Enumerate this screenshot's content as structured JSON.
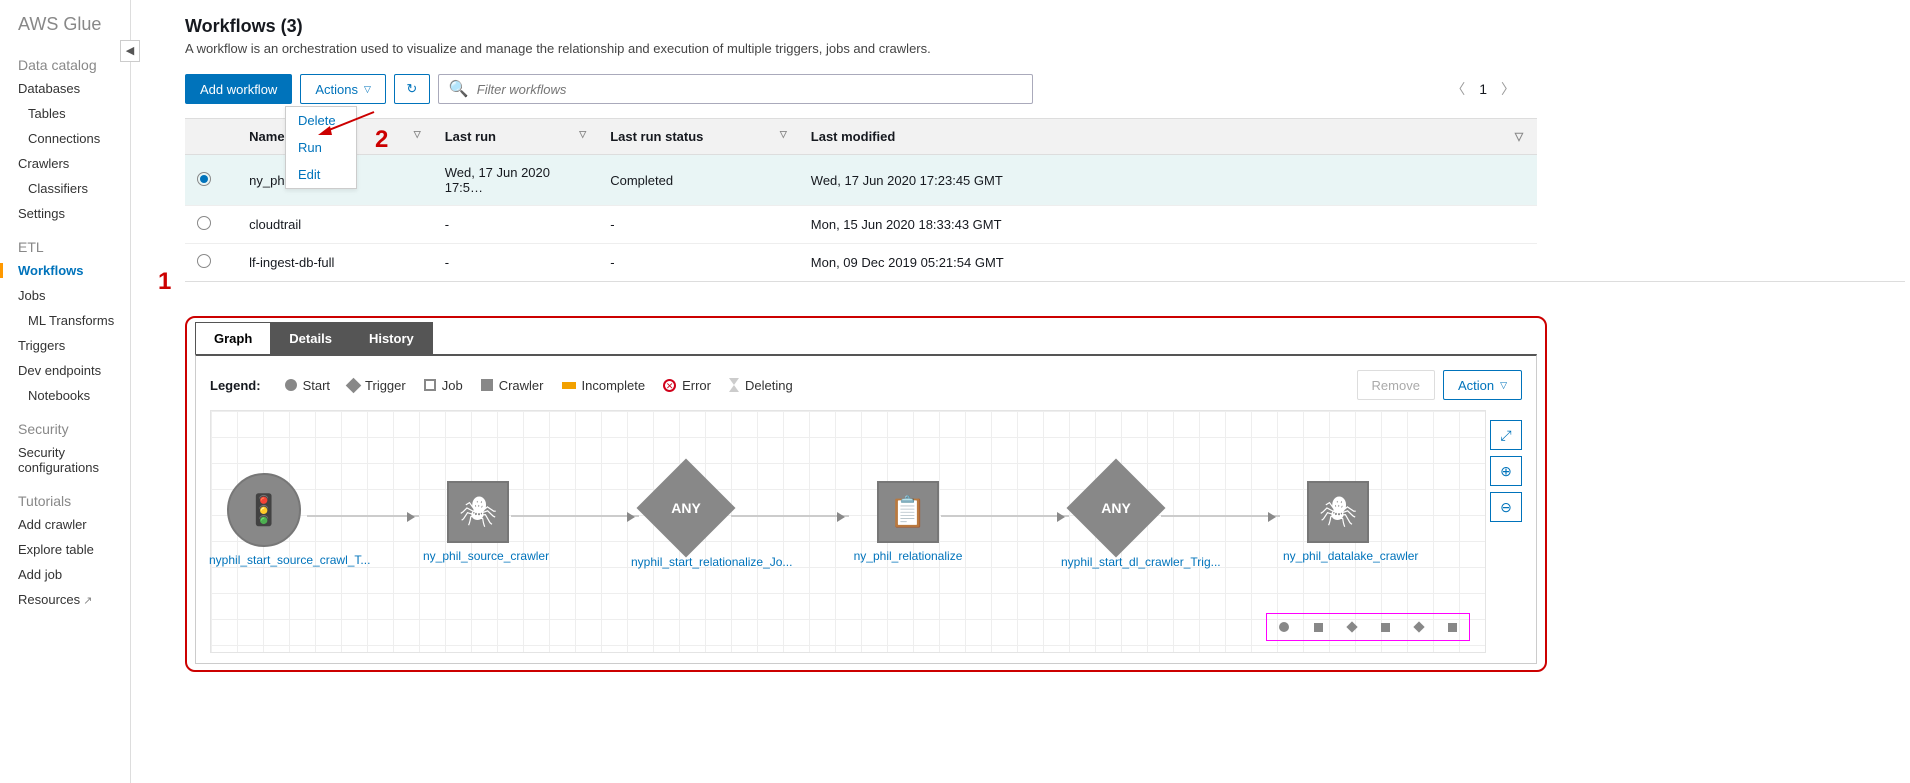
{
  "brand": "AWS Glue",
  "sidebar": {
    "catalog_header": "Data catalog",
    "etl_header": "ETL",
    "security_header": "Security",
    "tutorials_header": "Tutorials",
    "items": {
      "databases": "Databases",
      "tables": "Tables",
      "connections": "Connections",
      "crawlers": "Crawlers",
      "classifiers": "Classifiers",
      "settings": "Settings",
      "workflows": "Workflows",
      "jobs": "Jobs",
      "ml_transforms": "ML Transforms",
      "triggers": "Triggers",
      "dev_endpoints": "Dev endpoints",
      "notebooks": "Notebooks",
      "security_config": "Security configurations",
      "add_crawler": "Add crawler",
      "explore_table": "Explore table",
      "add_job": "Add job",
      "resources": "Resources"
    }
  },
  "page": {
    "title": "Workflows (3)",
    "desc": "A workflow is an orchestration used to visualize and manage the relationship and execution of multiple triggers, jobs and crawlers."
  },
  "toolbar": {
    "add": "Add workflow",
    "actions": "Actions",
    "filter_placeholder": "Filter workflows",
    "page_number": "1",
    "dropdown": {
      "delete": "Delete",
      "run": "Run",
      "edit": "Edit"
    }
  },
  "table": {
    "headers": {
      "name": "Name",
      "last_run": "Last run",
      "status": "Last run status",
      "modified": "Last modified"
    },
    "rows": [
      {
        "selected": true,
        "name": "ny_phil",
        "last_run": "Wed, 17 Jun 2020 17:5…",
        "status": "Completed",
        "modified": "Wed, 17 Jun 2020 17:23:45 GMT"
      },
      {
        "selected": false,
        "name": "cloudtrail",
        "last_run": "-",
        "status": "-",
        "modified": "Mon, 15 Jun 2020 18:33:43 GMT"
      },
      {
        "selected": false,
        "name": "lf-ingest-db-full",
        "last_run": "-",
        "status": "-",
        "modified": "Mon, 09 Dec 2019 05:21:54 GMT"
      }
    ]
  },
  "panel": {
    "tabs": {
      "graph": "Graph",
      "details": "Details",
      "history": "History"
    },
    "legend_label": "Legend:",
    "legend": {
      "start": "Start",
      "trigger": "Trigger",
      "job": "Job",
      "crawler": "Crawler",
      "incomplete": "Incomplete",
      "error": "Error",
      "deleting": "Deleting"
    },
    "remove": "Remove",
    "action": "Action"
  },
  "graph": {
    "any": "ANY",
    "nodes": [
      {
        "label": "nyphil_start_source_crawl_T..."
      },
      {
        "label": "ny_phil_source_crawler"
      },
      {
        "label": "nyphil_start_relationalize_Jo..."
      },
      {
        "label": "ny_phil_relationalize"
      },
      {
        "label": "nyphil_start_dl_crawler_Trig..."
      },
      {
        "label": "ny_phil_datalake_crawler"
      }
    ]
  },
  "anno": {
    "one": "1",
    "two": "2"
  }
}
